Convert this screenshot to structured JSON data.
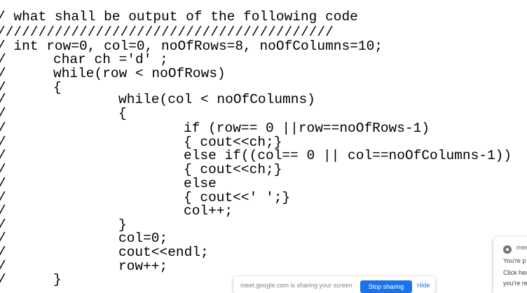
{
  "code": {
    "title": "/ what shall be output of the following code",
    "separator": "/////////////////////////////////////////",
    "lines": [
      "/ int row=0, col=0, noOfRows=8, noOfColumns=10;",
      "char ch ='d' ;",
      "while(row < noOfRows)",
      "{",
      "while(col < noOfColumns)",
      "{",
      "if (row== 0 ||row==noOfRows-1)",
      "{ cout<<ch;}",
      "else if((col== 0 || col==noOfColumns-1))",
      "{ cout<<ch;}",
      "else",
      "{ cout<<' ';}",
      "col++;",
      "}",
      "col=0;",
      "cout<<endl;",
      "row++;",
      "}"
    ],
    "gutter_slash": "/"
  },
  "notification": {
    "app": "mee",
    "line1": "You're p",
    "line2": "Click her",
    "line3": "you're re"
  },
  "sharebar": {
    "text": "meet.google.com is sharing your screen",
    "stop_label": "Stop sharing",
    "hide_label": "Hide"
  }
}
